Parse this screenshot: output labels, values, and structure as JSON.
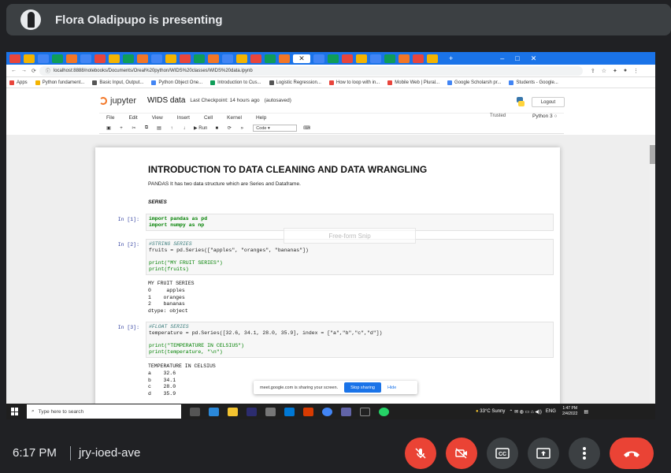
{
  "banner": {
    "presenter_text": "Flora Oladipupo is presenting"
  },
  "browser": {
    "url": "localhost:8888/notebooks/Documents/Oreal%20python/WIDS%20classes/WIDS%20data.ipynb",
    "bookmarks": [
      "Apps",
      "Python fundament...",
      "Basic Input, Output...",
      "Python Object One...",
      "Introduction to Cus...",
      "Logistic Regression...",
      "How to loop with in...",
      "Mobile Web | Plural...",
      "Google Scholarsh pr...",
      "Students - Google..."
    ]
  },
  "jupyter": {
    "logo_text": "jupyter",
    "notebook_name": "WIDS data",
    "checkpoint": "Last Checkpoint: 14 hours ago",
    "autosaved": "(autosaved)",
    "logout": "Logout",
    "menu": [
      "File",
      "Edit",
      "View",
      "Insert",
      "Cell",
      "Kernel",
      "Help"
    ],
    "trusted": "Trusted",
    "kernel": "Python 3",
    "toolbar": {
      "run": "Run",
      "cell_type": "Code"
    }
  },
  "notebook": {
    "title": "INTRODUCTION TO DATA CLEANING AND DATA WRANGLING",
    "intro": "PANDAS It has two data structure which are Series and Dataframe.",
    "section": "SERIES",
    "cells": [
      {
        "prompt": "In [1]:",
        "lines": [
          "import pandas as pd",
          "import numpy as np"
        ]
      },
      {
        "prompt": "In [2]:",
        "lines": [
          "#STRING SERIES",
          "fruits = pd.Series([\"apples\", \"oranges\", \"bananas\"])",
          "",
          "print(\"MY FRUIT SERIES\")",
          "print(fruits)"
        ],
        "output": [
          "MY FRUIT SERIES",
          "0     apples",
          "1    oranges",
          "2    bananas",
          "dtype: object"
        ]
      },
      {
        "prompt": "In [3]:",
        "lines": [
          "#FLOAT SERIES",
          "temperature = pd.Series([32.6, 34.1, 28.0, 35.9], index = [\"a\",\"b\",\"c\",\"d\"])",
          "",
          "print(\"TEMPERATURE IN CELSIUS\")",
          "print(temperature, \"\\n\")"
        ],
        "output": [
          "TEMPERATURE IN CELSIUS",
          "a    32.6",
          "b    34.1",
          "c    28.0",
          "d    35.9"
        ]
      }
    ]
  },
  "overlay": {
    "snip": "Free-form Snip",
    "share_notice": "meet.google.com is sharing your screen.",
    "stop_sharing": "Stop sharing",
    "hide": "Hide"
  },
  "taskbar": {
    "search_placeholder": "Type here to search",
    "weather": "33°C  Sunny",
    "lang": "ENG",
    "time": "1:47 PM",
    "date": "2/4/2022"
  },
  "meet": {
    "time": "6:17 PM",
    "code": "jry-ioed-ave"
  },
  "colors": {
    "accent": "#1a73e8",
    "danger": "#ea4335",
    "dark": "#202124"
  }
}
